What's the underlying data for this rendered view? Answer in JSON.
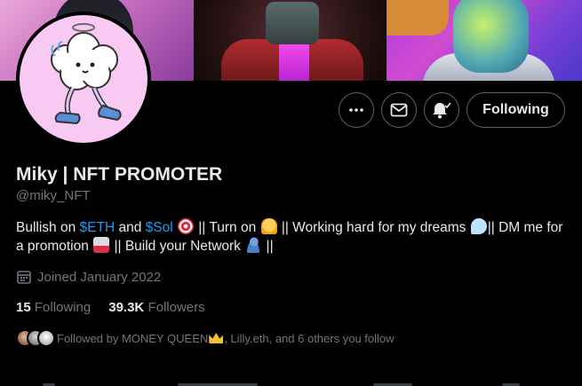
{
  "profile": {
    "name": "Miky | NFT PROMOTER",
    "handle": "@miky_NFT",
    "bio": {
      "part1": "Bullish on ",
      "eth": "$ETH",
      "part2": " and ",
      "sol": "$Sol",
      "part3": " || Turn on ",
      "part4": " || Working hard for my dreams ",
      "part5": "|| DM me for a promotion ",
      "part6": " || Build your Network ",
      "part7": " ||"
    },
    "joined": "Joined January 2022"
  },
  "actions": {
    "more": "more-icon",
    "message": "mail-icon",
    "notify": "bell-icon",
    "following_label": "Following"
  },
  "stats": {
    "following_count": "15",
    "following_label": "Following",
    "followers_count": "39.3K",
    "followers_label": "Followers"
  },
  "followed_by": {
    "prefix": "Followed by MONEY QUEEN",
    "suffix": ", Lilly.eth, and 6 others you follow"
  },
  "colors": {
    "background": "#000000",
    "link": "#1d9bf0",
    "muted": "#71767b",
    "border": "#536471",
    "text": "#e7e9ea"
  }
}
